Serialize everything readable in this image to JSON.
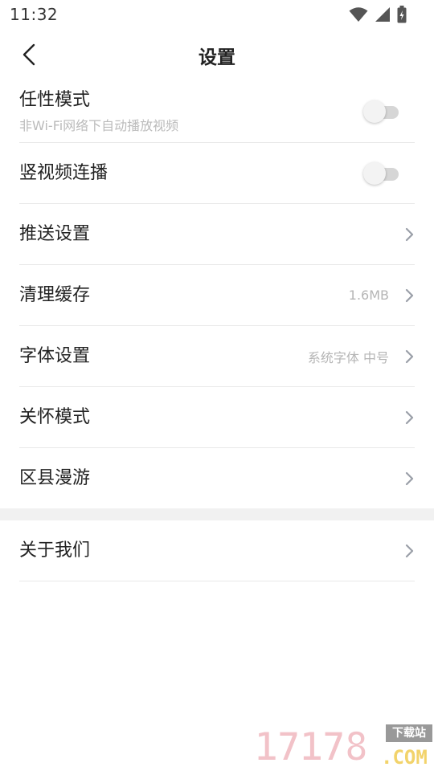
{
  "status_bar": {
    "time": "11:32",
    "icons": [
      "wifi-icon",
      "cell-signal-icon",
      "battery-charging-icon"
    ]
  },
  "nav": {
    "title": "设置",
    "back_icon": "chevron-left-icon"
  },
  "settings": {
    "wayward_mode": {
      "label": "任性模式",
      "sub": "非Wi-Fi网络下自动播放视频",
      "enabled": false
    },
    "vertical_autoplay": {
      "label": "竖视频连播",
      "enabled": false
    },
    "push": {
      "label": "推送设置"
    },
    "cache": {
      "label": "清理缓存",
      "value": "1.6MB"
    },
    "font": {
      "label": "字体设置",
      "value": "系统字体 中号"
    },
    "care_mode": {
      "label": "关怀模式"
    },
    "county_roam": {
      "label": "区县漫游"
    }
  },
  "about": {
    "label": "关于我们"
  },
  "watermark": {
    "digits": "17178",
    "badge": "下载站",
    "suffix": ".COM"
  },
  "colors": {
    "divider": "#e8e8e8",
    "section_gap": "#f1f1f1",
    "toggle_off_track": "#d6d6d6",
    "chevron": "#9a9fa8"
  }
}
